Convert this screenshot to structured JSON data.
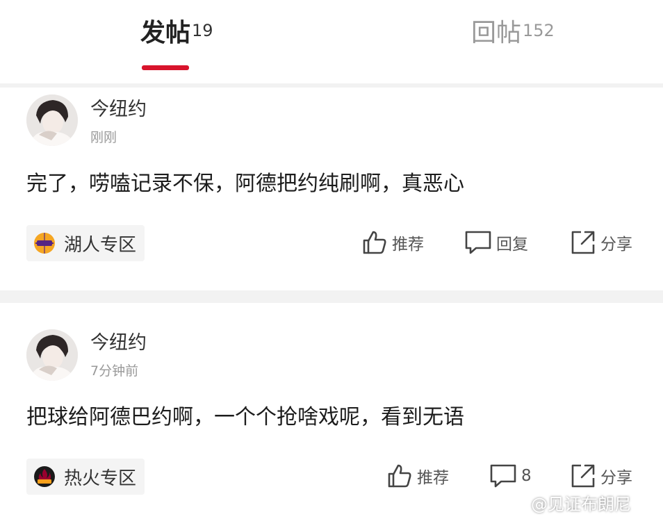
{
  "tabs": [
    {
      "label": "发帖",
      "count": "19"
    },
    {
      "label": "回帖",
      "count": "152"
    }
  ],
  "posts": [
    {
      "username": "今纽约",
      "time": "刚刚",
      "content": "完了，唠嗑记录不保，阿德把约纯刷啊，真恶心",
      "forum": "湖人专区",
      "actions": {
        "like": "推荐",
        "reply": "回复",
        "share": "分享"
      }
    },
    {
      "username": "今纽约",
      "time": "7分钟前",
      "content": "把球给阿德巴约啊，一个个抢啥戏呢，看到无语",
      "forum": "热火专区",
      "actions": {
        "like": "推荐",
        "reply": "8",
        "share": "分享"
      }
    }
  ],
  "watermark": "@见证布朗尼",
  "colors": {
    "accent": "#d8142c",
    "lakers": "#f5a623",
    "heat": "#98002e"
  }
}
